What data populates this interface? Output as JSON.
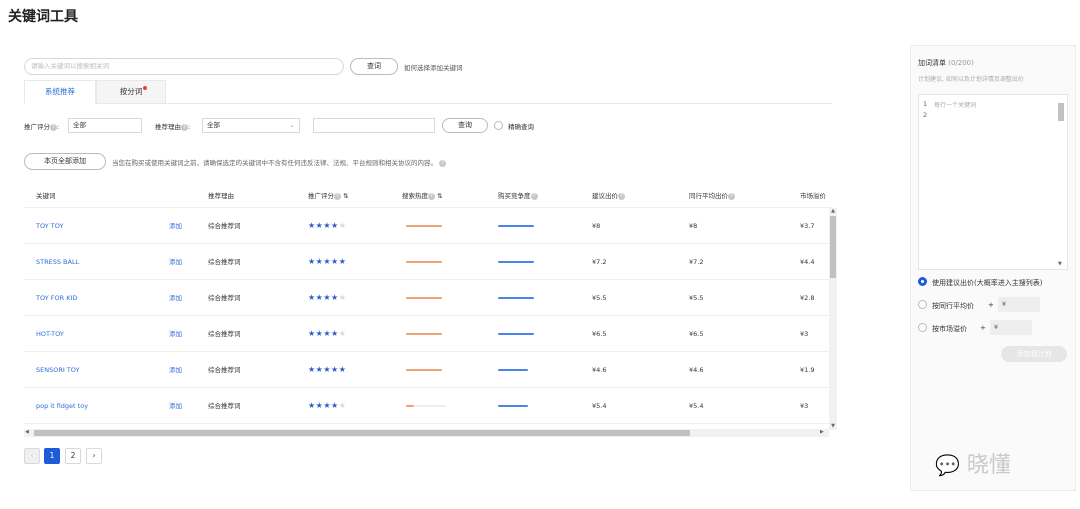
{
  "page_title": "关键词工具",
  "search": {
    "placeholder": "请输入关键词以搜索相关词",
    "button": "查词",
    "help_link": "如何选择添加关键词"
  },
  "tabs": [
    {
      "label": "系统推荐"
    },
    {
      "label": "按分词"
    }
  ],
  "filters": {
    "score_label": "推广评分",
    "score_value": "全部",
    "reason_label": "推荐理由",
    "reason_value": "全部",
    "query_button": "查询",
    "fuzzy_label": "精确查询"
  },
  "bulk": {
    "add_all": "本页全部添加",
    "notice": "当您在购买或使用关键词之前，请确保选定的关键词中不含有任何违反法律、法规、平台规则和相关协议的内容。"
  },
  "table": {
    "headers": [
      "关键词",
      "推荐理由",
      "推广评分",
      "搜索热度",
      "购买竞争度",
      "建议出价",
      "同行平均出价",
      "市场溢价"
    ],
    "add_label": "添加",
    "rows": [
      {
        "keyword": "TOY TOY",
        "reason": "综合推荐词",
        "stars": 4,
        "heat": 0.9,
        "comp": 0.9,
        "bid": "¥8",
        "avg": "¥8",
        "market": "¥3.7"
      },
      {
        "keyword": "STRESS BALL",
        "reason": "综合推荐词",
        "stars": 5,
        "heat": 0.9,
        "comp": 0.9,
        "bid": "¥7.2",
        "avg": "¥7.2",
        "market": "¥4.4"
      },
      {
        "keyword": "TOY FOR KID",
        "reason": "综合推荐词",
        "stars": 4,
        "heat": 0.9,
        "comp": 0.9,
        "bid": "¥5.5",
        "avg": "¥5.5",
        "market": "¥2.8"
      },
      {
        "keyword": "HOT-TOY",
        "reason": "综合推荐词",
        "stars": 4,
        "heat": 0.9,
        "comp": 0.9,
        "bid": "¥6.5",
        "avg": "¥6.5",
        "market": "¥3"
      },
      {
        "keyword": "SENSORI TOY",
        "reason": "综合推荐词",
        "stars": 5,
        "heat": 0.9,
        "comp": 0.75,
        "bid": "¥4.6",
        "avg": "¥4.6",
        "market": "¥1.9"
      },
      {
        "keyword": "pop it fidget toy",
        "reason": "综合推荐词",
        "stars": 4,
        "heat": 0.2,
        "comp": 0.75,
        "bid": "¥5.4",
        "avg": "¥5.4",
        "market": "¥3"
      }
    ]
  },
  "pagination": {
    "pages": [
      "1",
      "2"
    ],
    "current": "1",
    "prev": "‹",
    "next": "›"
  },
  "panel": {
    "title": "加词清单",
    "count": "(0/200)",
    "subtitle": "计划建议, 如何以及计划详情页调整出价",
    "line1": "1",
    "line2": "2",
    "editor_placeholder": "每行一个关键词",
    "opt_suggest": "使用建议出价(大概率进入主搜列表)",
    "opt_avg": "按同行平均价",
    "opt_market": "按市场溢价",
    "plus": "+",
    "yen": "¥",
    "submit": "添加到计划"
  },
  "colors": {
    "accent": "#1d5bd8",
    "link": "#2d6cd6",
    "heat": "#f0a07a",
    "comp": "#4a84e6"
  },
  "watermark": "晓懂"
}
